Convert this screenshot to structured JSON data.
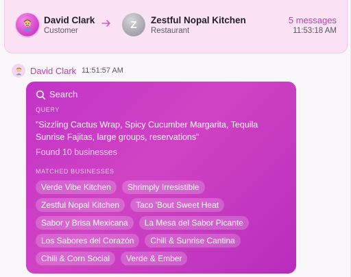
{
  "header": {
    "customer": {
      "name": "David Clark",
      "role": "Customer",
      "avatar_icon": "person-emoji-icon"
    },
    "restaurant": {
      "name": "Zestful Nopal Kitchen",
      "role": "Restaurant",
      "initial": "Z"
    },
    "arrow_icon": "arrow-right-icon",
    "message_count": "5 messages",
    "time": "11:53:18 AM"
  },
  "message": {
    "sender": "David Clark",
    "time": "11:51:57 AM",
    "search": {
      "title": "Search",
      "query_label": "QUERY",
      "query": "\"Sizzling Cactus Wrap, Spicy Cucumber Margarita, Tequila Sunrise Fajitas, large groups, reservations\"",
      "found": "Found 10 businesses",
      "matched_label": "MATCHED BUSINESSES",
      "businesses": [
        "Verde Vibe Kitchen",
        "Shrimply Irresistible",
        "Zestful Nopal Kitchen",
        "Taco 'Bout Sweet Heat",
        "Sabor y Brisa Mexicana",
        "La Mesa del Sabor Picante",
        "Los Sabores del Corazón",
        "Chili & Sunrise Cantina",
        "Chili & Corn Social",
        "Verde & Ember"
      ]
    }
  },
  "colors": {
    "accent": "#c13bb4",
    "bubble": "#c234c6",
    "header_bg": "#fbe3f5"
  }
}
